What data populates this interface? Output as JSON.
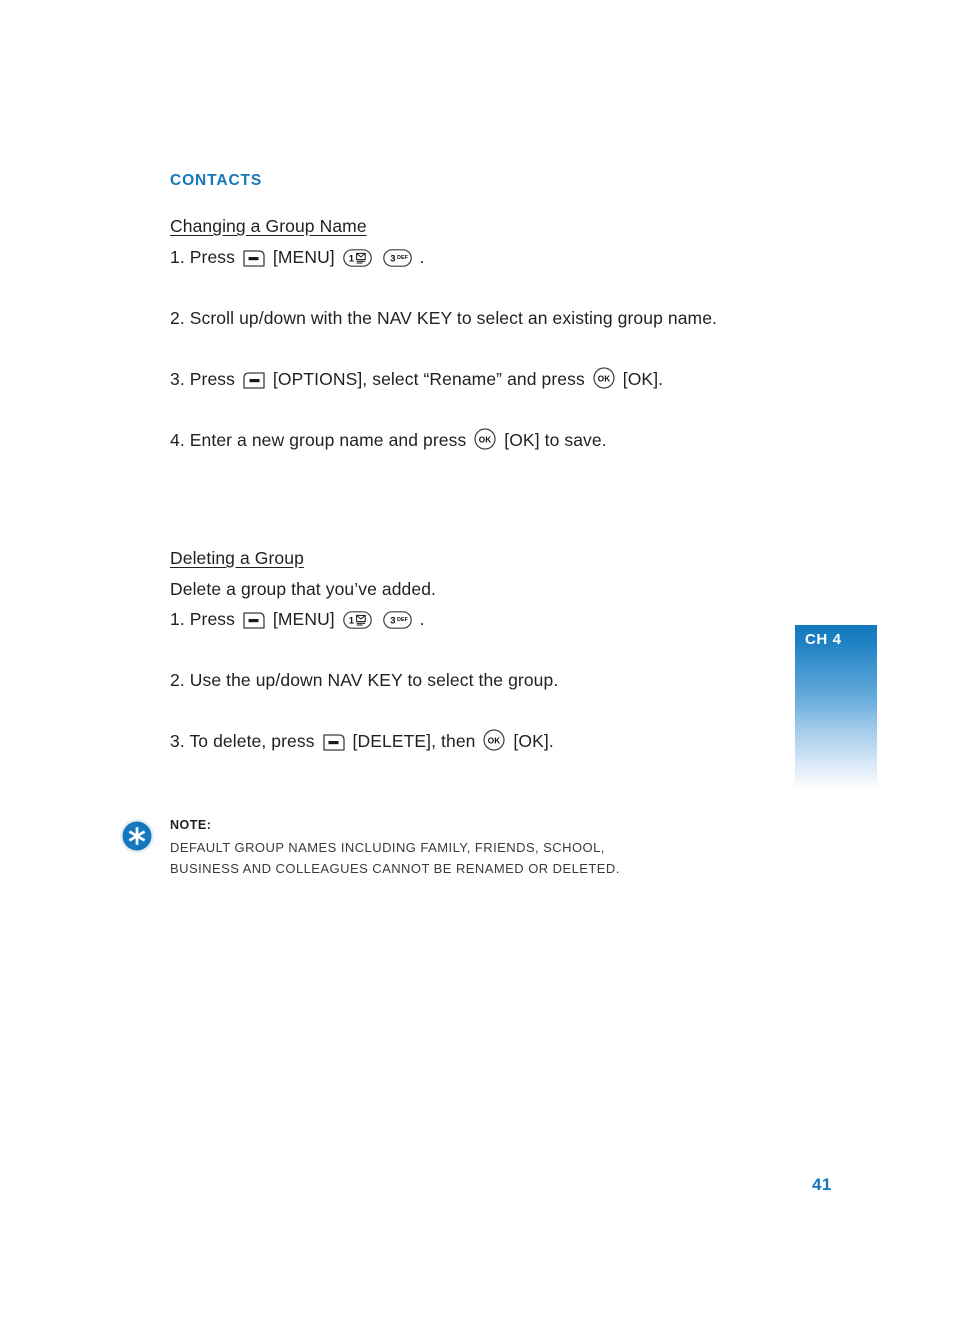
{
  "page": {
    "number": "41",
    "chapter_tab": "CH 4",
    "accent_color": "#1378bd",
    "text_color": "#231f20"
  },
  "section": {
    "title": "CONTACTS"
  },
  "topics": [
    {
      "heading": "Changing a Group Name",
      "intro": "",
      "steps": [
        {
          "id": "change-step-1",
          "parts": [
            {
              "type": "text",
              "value": "1. Press "
            },
            {
              "type": "key",
              "icon": "softkey-left-icon",
              "label": "left soft key"
            },
            {
              "type": "text",
              "value": " [MENU] "
            },
            {
              "type": "key",
              "icon": "keypad-1-voicemail-icon",
              "label": "1"
            },
            {
              "type": "text",
              "value": "  "
            },
            {
              "type": "key",
              "icon": "keypad-3-def-icon",
              "label": "3 DEF"
            },
            {
              "type": "text",
              "value": " ."
            }
          ]
        },
        {
          "id": "change-step-2",
          "parts": [
            {
              "type": "text",
              "value": "2. Scroll up/down with the NAV KEY to select an existing group name."
            }
          ]
        },
        {
          "id": "change-step-3",
          "parts": [
            {
              "type": "text",
              "value": "3. Press "
            },
            {
              "type": "key",
              "icon": "softkey-right-icon",
              "label": "right soft key"
            },
            {
              "type": "text",
              "value": " [OPTIONS], select “Rename” and press "
            },
            {
              "type": "key",
              "icon": "ok-key-icon",
              "label": "OK"
            },
            {
              "type": "text",
              "value": " [OK]."
            }
          ]
        },
        {
          "id": "change-step-4",
          "parts": [
            {
              "type": "text",
              "value": "4. Enter a new group name and press "
            },
            {
              "type": "key",
              "icon": "ok-key-icon",
              "label": "OK"
            },
            {
              "type": "text",
              "value": "  [OK] to save."
            }
          ]
        }
      ]
    },
    {
      "heading": "Deleting a Group",
      "intro": "Delete a group that you’ve added.",
      "steps": [
        {
          "id": "delete-step-1",
          "parts": [
            {
              "type": "text",
              "value": "1. Press "
            },
            {
              "type": "key",
              "icon": "softkey-left-icon",
              "label": "left soft key"
            },
            {
              "type": "text",
              "value": " [MENU] "
            },
            {
              "type": "key",
              "icon": "keypad-1-voicemail-icon",
              "label": "1"
            },
            {
              "type": "text",
              "value": "  "
            },
            {
              "type": "key",
              "icon": "keypad-3-def-icon",
              "label": "3 DEF"
            },
            {
              "type": "text",
              "value": " ."
            }
          ]
        },
        {
          "id": "delete-step-2",
          "parts": [
            {
              "type": "text",
              "value": "2. Use the up/down NAV KEY to select the group."
            }
          ]
        },
        {
          "id": "delete-step-3",
          "parts": [
            {
              "type": "text",
              "value": "3. To delete, press "
            },
            {
              "type": "key",
              "icon": "softkey-left-icon",
              "label": "left soft key"
            },
            {
              "type": "text",
              "value": " [DELETE], then "
            },
            {
              "type": "key",
              "icon": "ok-key-icon",
              "label": "OK"
            },
            {
              "type": "text",
              "value": " [OK]."
            }
          ]
        }
      ]
    }
  ],
  "note": {
    "icon": "asterisk-badge-icon",
    "label": "NOTE:",
    "text": "DEFAULT GROUP NAMES INCLUDING FAMILY, FRIENDS, SCHOOL, BUSINESS AND COLLEAGUES CANNOT BE RENAMED OR DELETED.",
    "icon_color": "#1378bd"
  },
  "keypad_glyphs": {
    "keypad_1_digit": "1",
    "keypad_3_digit": "3",
    "keypad_3_letters": "DEF",
    "ok_label": "OK"
  }
}
